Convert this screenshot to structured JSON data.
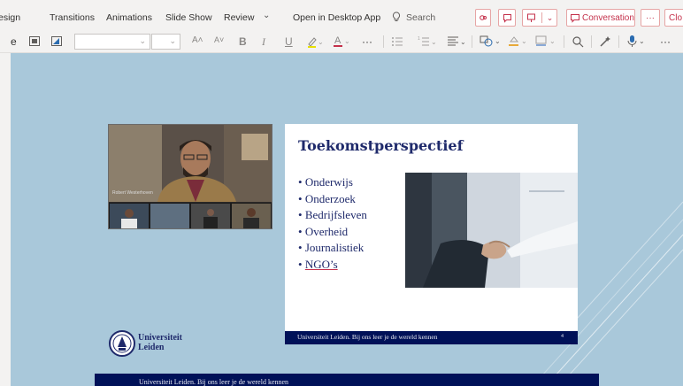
{
  "ribbon": {
    "tabs": [
      "esign",
      "Transitions",
      "Animations",
      "Slide Show",
      "Review"
    ],
    "more_chevron": "⌄",
    "open_desktop": "Open in Desktop App",
    "search": "Search",
    "conversation": "Conversation",
    "overflow": "···",
    "close": "Clo"
  },
  "toolbar": {
    "layout_label": "e",
    "font_grow": "A˄",
    "font_shrink": "A˅",
    "bold": "B",
    "italic": "I",
    "underline": "U",
    "more": "···",
    "overflow": "···"
  },
  "video": {
    "speaker_name": "Robert Westerhoven"
  },
  "slide": {
    "title": "Toekomstperspectief",
    "bullets": [
      "Onderwijs",
      "Onderzoek",
      "Bedrijfsleven",
      "Overheid",
      "Journalistiek",
      "NGO’s"
    ],
    "bullet_char": "•",
    "footer_text": "Universiteit Leiden. Bij ons leer je de wereld kennen",
    "page_number": "4"
  },
  "logo": {
    "line1": "Universiteit",
    "line2": "Leiden"
  },
  "bottom_bar_text": "Universiteit Leiden. Bij ons leer je de wereld kennen",
  "colors": {
    "canvas_bg": "#a9c8da",
    "leiden_navy": "#001158",
    "title_navy": "#1f2a6b",
    "accent_red": "#c4314b"
  }
}
